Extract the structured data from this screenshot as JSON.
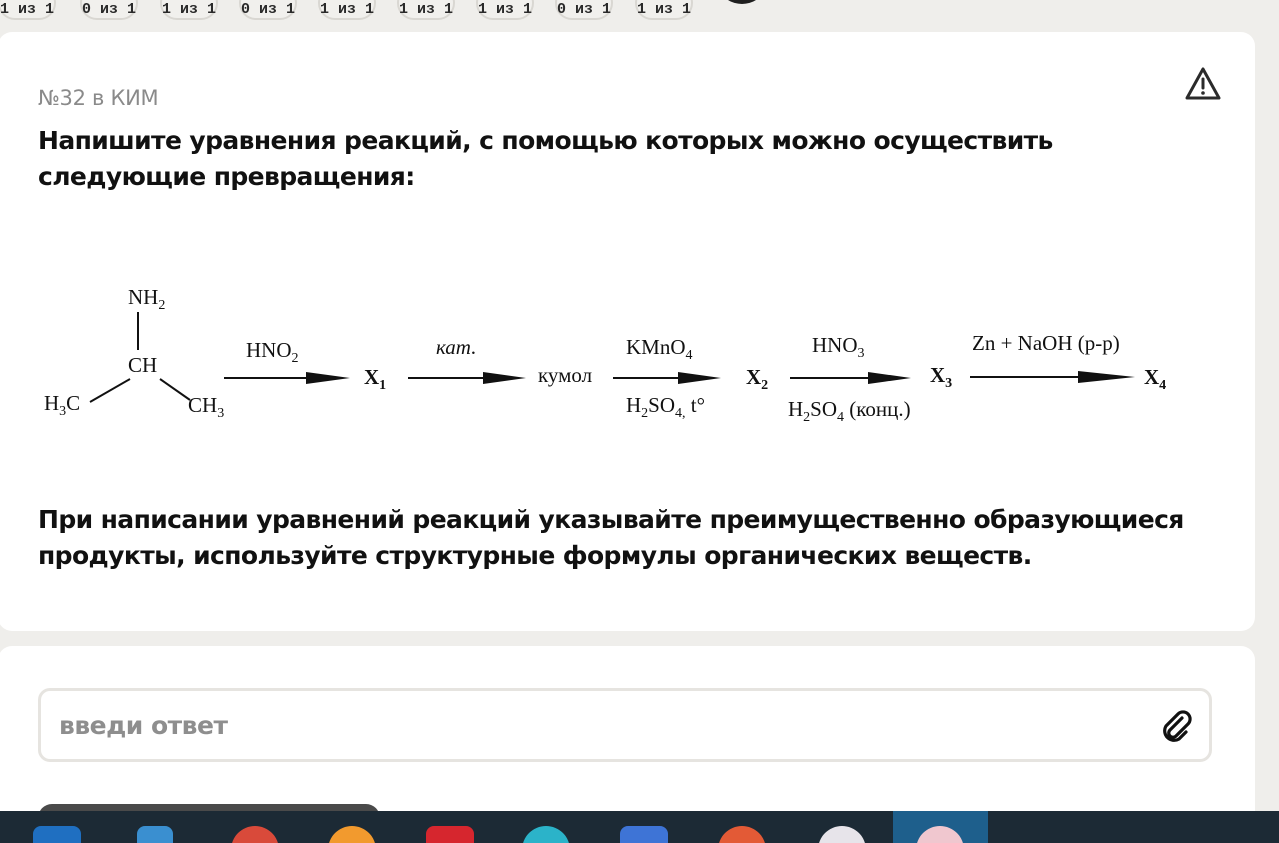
{
  "score_pills": [
    "1 из 1",
    "0 из 1",
    "1 из 1",
    "0 из 1",
    "1 из 1",
    "1 из 1",
    "1 из 1",
    "0 из 1",
    "1 из 1"
  ],
  "question": {
    "kim_label": "№32 в КИМ",
    "task_text": "Напишите уравнения реакций, с помощью которых можно осуществить следующие превращения:",
    "note_text": "При написании уравнений реакций указывайте преимущественно образующиеся продукты, используйте структурные формулы органических веществ.",
    "report_icon": "warning-triangle-icon"
  },
  "scheme": {
    "start_atoms": {
      "nh2": "NH",
      "nh2_sub": "2",
      "ch": "CH",
      "h3c": "H",
      "h3c_sub": "3",
      "h3c_tail": "C",
      "ch3": "CH",
      "ch3_sub": "3"
    },
    "step1": {
      "above": "HNO",
      "above_sub": "2",
      "product": "X",
      "product_sub": "1"
    },
    "step2": {
      "above": "кат.",
      "product": "кумол"
    },
    "step3": {
      "above": "KMnO",
      "above_sub": "4",
      "below_1": "H",
      "below_1_sub": "2",
      "below_2": "SO",
      "below_2_sub": "4,",
      "below_3": " t°",
      "product": "X",
      "product_sub": "2"
    },
    "step4": {
      "above": "HNO",
      "above_sub": "3",
      "below_1": "H",
      "below_1_sub": "2",
      "below_2": "SO",
      "below_2_sub": "4",
      "below_3": " (конц.)",
      "product": "X",
      "product_sub": "3"
    },
    "step5": {
      "above": "Zn + NaOH (р-р)",
      "product": "X",
      "product_sub": "4"
    }
  },
  "answer": {
    "placeholder": "введи ответ",
    "value": "",
    "attach_icon": "paperclip-icon"
  },
  "taskbar": {
    "icons": [
      "mail-icon",
      "calculator-icon",
      "chrome-icon",
      "app-orange-icon",
      "document-red-icon",
      "app-cyan-icon",
      "app-blue-icon",
      "media-icon",
      "yandex-icon",
      "yandex-active-icon"
    ],
    "colors": [
      "#1f6fc1",
      "#3a8fd0",
      "#d94a3a",
      "#f29a2e",
      "#d6262e",
      "#2bb3c9",
      "#3e74d6",
      "#e35a36",
      "#e7e4ea",
      "#f0c7cf"
    ]
  }
}
